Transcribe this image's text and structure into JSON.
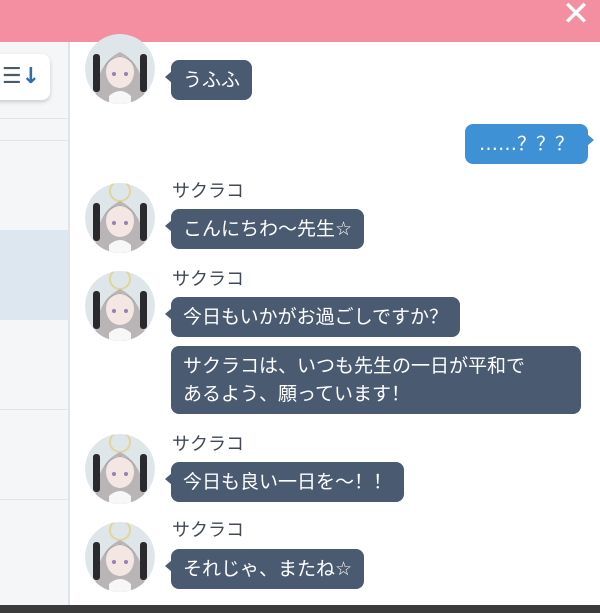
{
  "header": {
    "close_icon": "close-icon"
  },
  "sidebar": {
    "sort_glyph": "☰",
    "sort_arrow": "↓",
    "sort_icon": "sort-descending-icon"
  },
  "messages": {
    "m0": {
      "text": "うふふ"
    },
    "m1": {
      "text": "……？？？"
    },
    "m2": {
      "sender": "サクラコ",
      "text": "こんにちわ～先生☆"
    },
    "m3": {
      "sender": "サクラコ",
      "text1": "今日もいかがお過ごしですか？",
      "text2_line1": "サクラコは、いつも先生の一日が平和で",
      "text2_line2": "あるよう、願っています！"
    },
    "m4": {
      "sender": "サクラコ",
      "text": "今日も良い一日を～！！"
    },
    "m5": {
      "sender": "サクラコ",
      "text": "それじゃ、またね☆"
    }
  },
  "colors": {
    "topbar": "#f48fa1",
    "bubble_other": "#4a5a70",
    "bubble_me": "#3f91d6",
    "sender_name": "#3f4a56"
  }
}
